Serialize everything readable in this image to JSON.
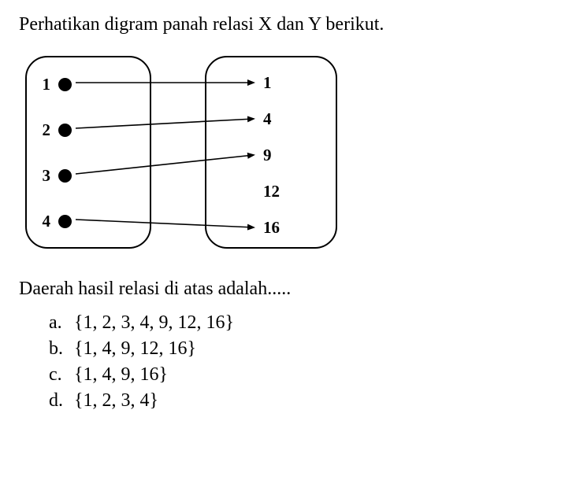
{
  "question": "Perhatikan digram panah relasi X dan Y berikut.",
  "result_text": "Daerah hasil relasi di atas adalah.....",
  "chart_data": {
    "type": "diagram",
    "description": "Arrow/mapping diagram between set X and set Y",
    "set_x": [
      "1",
      "2",
      "3",
      "4"
    ],
    "set_y": [
      "1",
      "4",
      "9",
      "12",
      "16"
    ],
    "mappings": [
      {
        "from": "1",
        "to": "1"
      },
      {
        "from": "2",
        "to": "4"
      },
      {
        "from": "3",
        "to": "9"
      },
      {
        "from": "4",
        "to": "16"
      }
    ]
  },
  "options": [
    {
      "letter": "a.",
      "text": "{1, 2, 3, 4, 9, 12, 16}"
    },
    {
      "letter": "b.",
      "text": "{1, 4, 9, 12, 16}"
    },
    {
      "letter": "c.",
      "text": "{1, 4, 9, 16}"
    },
    {
      "letter": "d.",
      "text": "{1, 2, 3, 4}"
    }
  ]
}
